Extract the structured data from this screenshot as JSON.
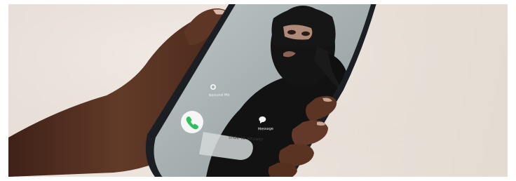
{
  "photo": {
    "alt_subject": "hand-holding-phone-with-incoming-call",
    "colors": {
      "background": "#e9e2da",
      "skin": "#5b3323",
      "phone_frame": "#1b1f24",
      "screen": "#a9b2b3",
      "balaclava": "#141414",
      "accept_green": "#2ec05a"
    }
  },
  "call_screen": {
    "reminder_label": "Remind Me",
    "message_label": "Message",
    "slide_label": "slide to answer",
    "icons": {
      "reminder": "alarm-icon",
      "message": "message-bubble-icon",
      "accept": "phone-icon"
    }
  }
}
